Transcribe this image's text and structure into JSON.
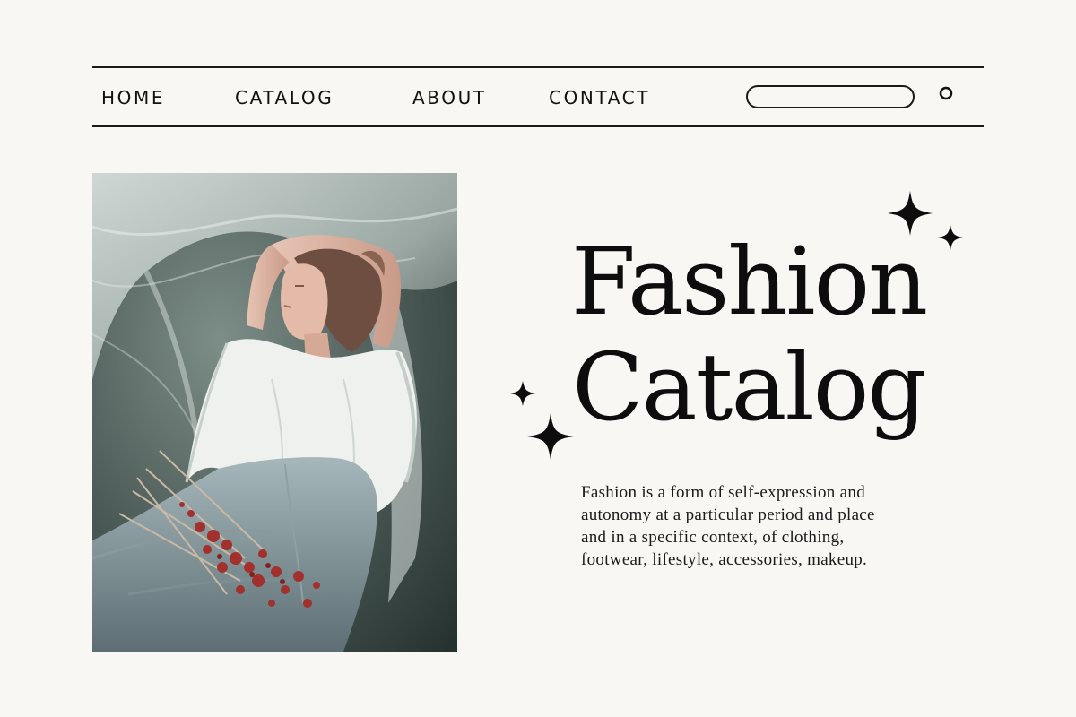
{
  "nav": {
    "links": [
      {
        "label": "HOME"
      },
      {
        "label": "CATALOG"
      },
      {
        "label": "ABOUT"
      },
      {
        "label": "CONTACT"
      }
    ],
    "search": {
      "placeholder": "",
      "icon": "search-icon"
    }
  },
  "hero": {
    "title_line1": "Fashion",
    "title_line2": "Catalog",
    "description": "Fashion is a form of self-expression and autonomy at a particular period and place and in a specific context, of clothing, footwear, lifestyle, accessories, makeup.",
    "photo_icon": "fashion-model-photo",
    "decoration_icon": "sparkle-icon"
  },
  "colors": {
    "background": "#f9f7f4",
    "text": "#0d0d0d",
    "photo_base": "#3c4947",
    "accent_flowers": "#a2302c"
  }
}
